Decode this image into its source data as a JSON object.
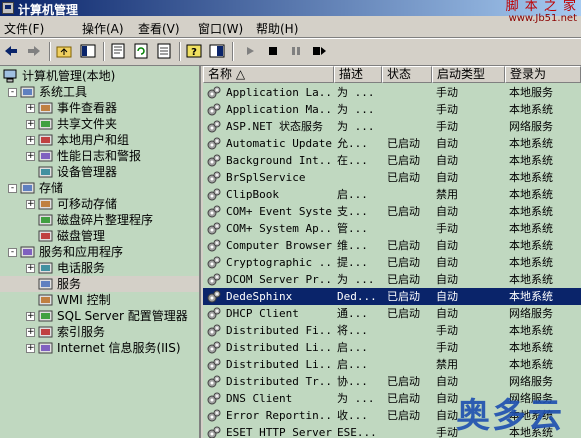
{
  "window": {
    "title": "计算机管理"
  },
  "watermark_top": {
    "brand": "脚 本 之 家",
    "url": "www.Jb51.net"
  },
  "watermark_bottom": "奥多云",
  "menu": [
    {
      "label": "文件(F)"
    },
    {
      "label": "操作(A)"
    },
    {
      "label": "查看(V)"
    },
    {
      "label": "窗口(W)"
    },
    {
      "label": "帮助(H)"
    }
  ],
  "tree": {
    "root": "计算机管理(本地)",
    "items": [
      {
        "label": "系统工具",
        "level": 1,
        "exp": "-",
        "icon": "tools-icon"
      },
      {
        "label": "事件查看器",
        "level": 2,
        "exp": "+",
        "icon": "event-viewer-icon"
      },
      {
        "label": "共享文件夹",
        "level": 2,
        "exp": "+",
        "icon": "shared-folder-icon"
      },
      {
        "label": "本地用户和组",
        "level": 2,
        "exp": "+",
        "icon": "users-icon"
      },
      {
        "label": "性能日志和警报",
        "level": 2,
        "exp": "+",
        "icon": "performance-icon"
      },
      {
        "label": "设备管理器",
        "level": 2,
        "exp": "",
        "icon": "device-manager-icon"
      },
      {
        "label": "存储",
        "level": 1,
        "exp": "-",
        "icon": "storage-icon"
      },
      {
        "label": "可移动存储",
        "level": 2,
        "exp": "+",
        "icon": "removable-storage-icon"
      },
      {
        "label": "磁盘碎片整理程序",
        "level": 2,
        "exp": "",
        "icon": "defrag-icon"
      },
      {
        "label": "磁盘管理",
        "level": 2,
        "exp": "",
        "icon": "disk-management-icon"
      },
      {
        "label": "服务和应用程序",
        "level": 1,
        "exp": "-",
        "icon": "services-apps-icon"
      },
      {
        "label": "电话服务",
        "level": 2,
        "exp": "+",
        "icon": "telephony-icon"
      },
      {
        "label": "服务",
        "level": 2,
        "exp": "",
        "icon": "services-icon",
        "selected": true
      },
      {
        "label": "WMI 控制",
        "level": 2,
        "exp": "",
        "icon": "wmi-icon"
      },
      {
        "label": "SQL Server 配置管理器",
        "level": 2,
        "exp": "+",
        "icon": "sql-icon"
      },
      {
        "label": "索引服务",
        "level": 2,
        "exp": "+",
        "icon": "index-icon"
      },
      {
        "label": "Internet 信息服务(IIS)",
        "level": 2,
        "exp": "+",
        "icon": "iis-icon"
      }
    ]
  },
  "columns": [
    {
      "label": "名称 △"
    },
    {
      "label": "描述"
    },
    {
      "label": "状态"
    },
    {
      "label": "启动类型"
    },
    {
      "label": "登录为"
    }
  ],
  "services": [
    {
      "name": "Application La...",
      "desc": "为 ...",
      "status": "",
      "start": "手动",
      "logon": "本地服务"
    },
    {
      "name": "Application Ma...",
      "desc": "为 ...",
      "status": "",
      "start": "手动",
      "logon": "本地系统"
    },
    {
      "name": "ASP.NET 状态服务",
      "desc": "为 ...",
      "status": "",
      "start": "手动",
      "logon": "网络服务"
    },
    {
      "name": "Automatic Updates",
      "desc": "允...",
      "status": "已启动",
      "start": "自动",
      "logon": "本地系统"
    },
    {
      "name": "Background Int...",
      "desc": "在...",
      "status": "已启动",
      "start": "自动",
      "logon": "本地系统"
    },
    {
      "name": "BrSplService",
      "desc": "",
      "status": "已启动",
      "start": "自动",
      "logon": "本地系统"
    },
    {
      "name": "ClipBook",
      "desc": "启...",
      "status": "",
      "start": "禁用",
      "logon": "本地系统"
    },
    {
      "name": "COM+ Event System",
      "desc": "支...",
      "status": "已启动",
      "start": "自动",
      "logon": "本地系统"
    },
    {
      "name": "COM+ System Ap...",
      "desc": "管...",
      "status": "",
      "start": "手动",
      "logon": "本地系统"
    },
    {
      "name": "Computer Browser",
      "desc": "维...",
      "status": "已启动",
      "start": "自动",
      "logon": "本地系统"
    },
    {
      "name": "Cryptographic ...",
      "desc": "提...",
      "status": "已启动",
      "start": "自动",
      "logon": "本地系统"
    },
    {
      "name": "DCOM Server Pr...",
      "desc": "为 ...",
      "status": "已启动",
      "start": "自动",
      "logon": "本地系统"
    },
    {
      "name": "DedeSphinx",
      "desc": "Ded...",
      "status": "已启动",
      "start": "自动",
      "logon": "本地系统",
      "selected": true
    },
    {
      "name": "DHCP Client",
      "desc": "通...",
      "status": "已启动",
      "start": "自动",
      "logon": "网络服务"
    },
    {
      "name": "Distributed Fi...",
      "desc": "将...",
      "status": "",
      "start": "手动",
      "logon": "本地系统"
    },
    {
      "name": "Distributed Li...",
      "desc": "启...",
      "status": "",
      "start": "手动",
      "logon": "本地系统"
    },
    {
      "name": "Distributed Li...",
      "desc": "启...",
      "status": "",
      "start": "禁用",
      "logon": "本地系统"
    },
    {
      "name": "Distributed Tr...",
      "desc": "协...",
      "status": "已启动",
      "start": "自动",
      "logon": "网络服务"
    },
    {
      "name": "DNS Client",
      "desc": "为 ...",
      "status": "已启动",
      "start": "自动",
      "logon": "网络服务"
    },
    {
      "name": "Error Reportin...",
      "desc": "收...",
      "status": "已启动",
      "start": "自动",
      "logon": "本地系统"
    },
    {
      "name": "ESET HTTP Server",
      "desc": "ESE...",
      "status": "",
      "start": "手动",
      "logon": "本地系统"
    }
  ]
}
